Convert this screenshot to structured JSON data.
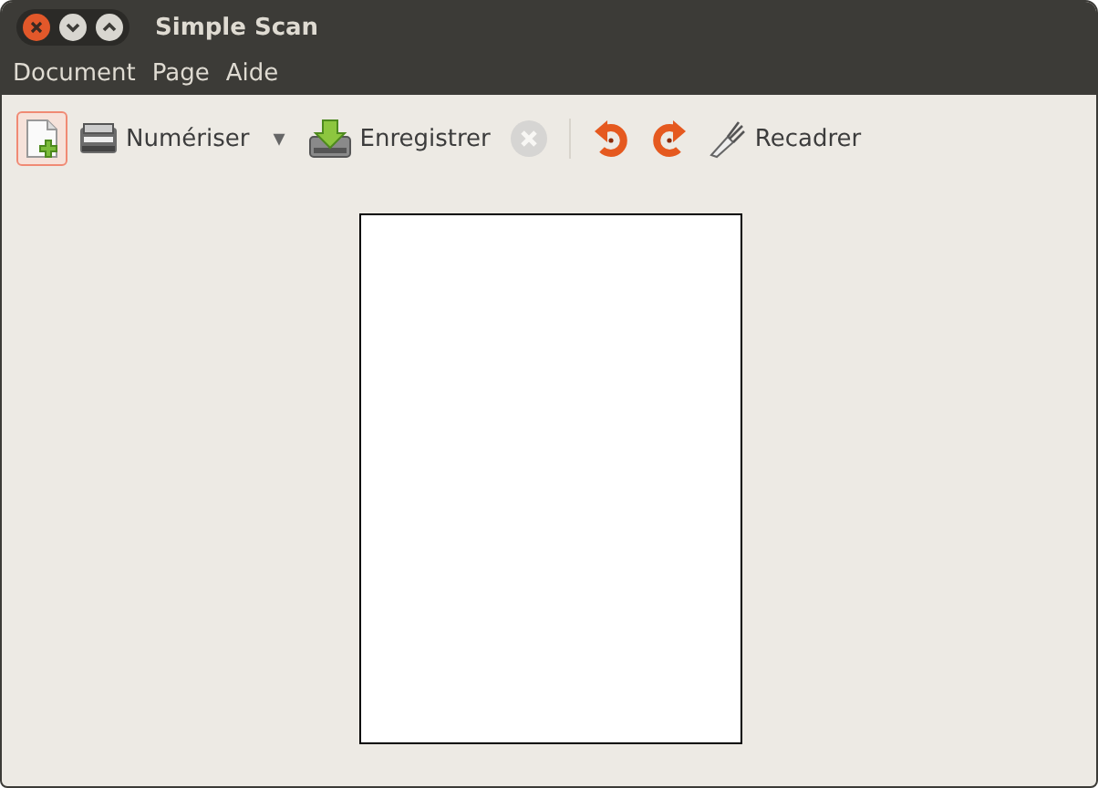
{
  "window": {
    "title": "Simple Scan"
  },
  "menu": [
    "Document",
    "Page",
    "Aide"
  ],
  "toolbar": [
    {
      "kind": "new",
      "highlighted": true,
      "disabled": false
    },
    {
      "kind": "scan",
      "label": "Numériser",
      "disabled": false
    },
    {
      "kind": "dropdown",
      "label": "▾",
      "disabled": false
    },
    {
      "kind": "save",
      "label": "Enregistrer",
      "disabled": false
    },
    {
      "kind": "stop",
      "disabled": true
    },
    {
      "kind": "separator"
    },
    {
      "kind": "rotate-left",
      "disabled": false
    },
    {
      "kind": "rotate-right",
      "disabled": false
    },
    {
      "kind": "crop",
      "label": "Recadrer",
      "disabled": false
    }
  ],
  "page": {
    "kind": "blank"
  }
}
